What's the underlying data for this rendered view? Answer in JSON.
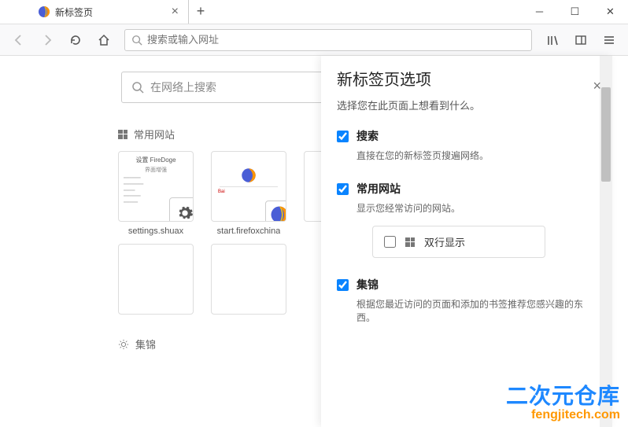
{
  "tab": {
    "title": "新标签页"
  },
  "urlbar": {
    "placeholder": "搜索或输入网址"
  },
  "newtab": {
    "search_placeholder": "在网络上搜索",
    "section_topsites": "常用网站",
    "section_highlights": "集锦",
    "tiles": [
      {
        "label": "settings.shuax",
        "thumb_title": "设置 FireDoge",
        "thumb_line": "界面增强"
      },
      {
        "label": "start.firefoxchina"
      }
    ]
  },
  "panel": {
    "title": "新标签页选项",
    "subtitle": "选择您在此页面上想看到什么。",
    "opts": [
      {
        "label": "搜索",
        "desc": "直接在您的新标签页搜遍网络。",
        "checked": true
      },
      {
        "label": "常用网站",
        "desc": "显示您经常访问的网站。",
        "checked": true,
        "sub": {
          "label": "双行显示",
          "checked": false
        }
      },
      {
        "label": "集锦",
        "desc": "根据您最近访问的页面和添加的书签推荐您感兴趣的东西。",
        "checked": true
      }
    ]
  },
  "watermark": {
    "line1": "二次元仓库",
    "line2": "fengjitech.com"
  }
}
